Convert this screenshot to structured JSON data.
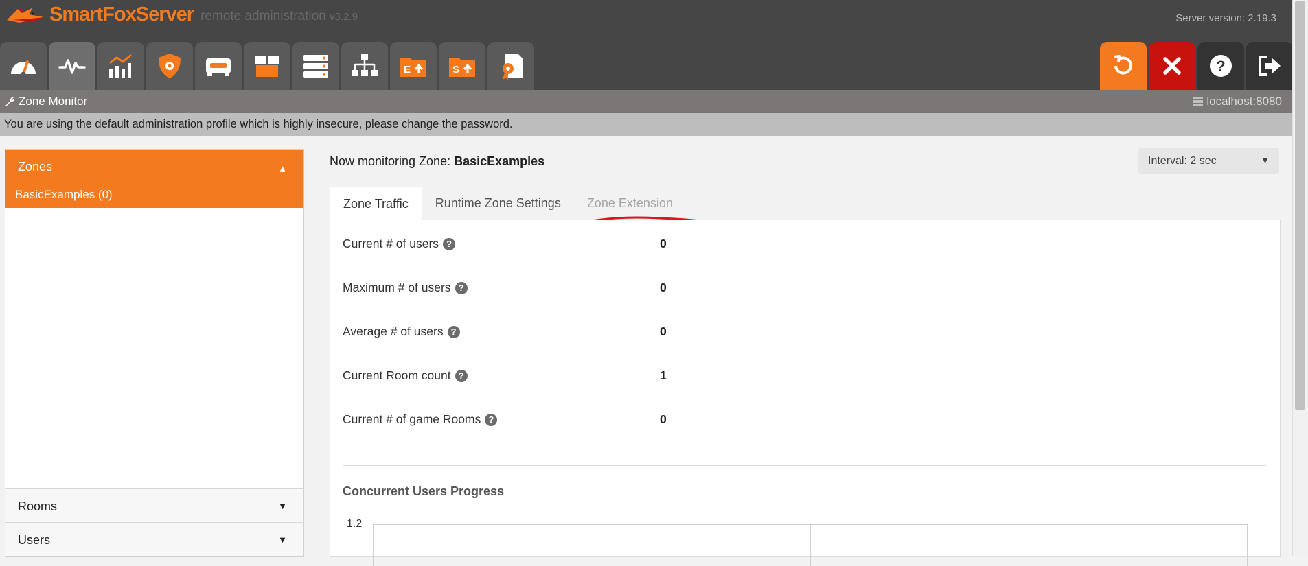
{
  "app": {
    "logo_title": "SmartFoxServer",
    "logo_sub": "remote administration",
    "logo_version": "v3.2.9",
    "server_version": "Server version: 2.19.3"
  },
  "toolbar": {
    "tools": [
      "dashboard-icon",
      "zone-monitor-icon",
      "analytics-icon",
      "security-icon",
      "console-icon",
      "box-icon",
      "servers-icon",
      "hierarchy-icon",
      "extension-upload-icon",
      "server-upload-icon",
      "license-icon"
    ],
    "actions": [
      "restart-icon",
      "halt-icon",
      "help-icon",
      "logout-icon"
    ],
    "colors": {
      "orange": "#f47a20",
      "red": "#c8120d",
      "dark": "#333333"
    }
  },
  "subbar": {
    "title": "Zone Monitor",
    "host": "localhost:8080"
  },
  "warning": "You are using the default administration profile which is highly insecure, please change the password.",
  "sidebar": {
    "zones_label": "Zones",
    "zone_items": [
      "BasicExamples (0)"
    ],
    "rooms_label": "Rooms",
    "users_label": "Users"
  },
  "main": {
    "monitor_prefix": "Now monitoring Zone: ",
    "monitor_zone": "BasicExamples",
    "interval": "Interval: 2 sec",
    "tabs": [
      {
        "label": "Zone Traffic",
        "state": "active"
      },
      {
        "label": "Runtime Zone Settings",
        "state": "normal"
      },
      {
        "label": "Zone Extension",
        "state": "disabled"
      }
    ],
    "stats": [
      {
        "label": "Current # of users",
        "value": "0"
      },
      {
        "label": "Maximum # of users",
        "value": "0"
      },
      {
        "label": "Average # of users",
        "value": "0"
      },
      {
        "label": "Current Room count",
        "value": "1"
      },
      {
        "label": "Current # of game Rooms",
        "value": "0"
      }
    ],
    "chart_title": "Concurrent Users Progress",
    "chart_y_top": "1.2"
  }
}
